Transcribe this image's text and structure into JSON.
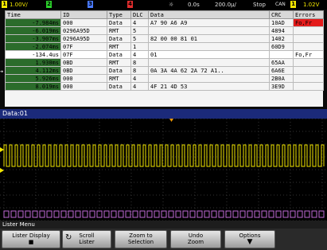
{
  "status": {
    "ch1_num": "1",
    "ch1_scale": "1.00V/",
    "ch2_num": "2",
    "ch3_num": "3",
    "ch4_num": "4",
    "trig_icon": "sun-icon",
    "delay": "0.0s",
    "timebase": "200.0µ/",
    "run_state": "Stop",
    "trigger_source": "CAN",
    "trigger_ch": "1",
    "trigger_level": "1.02V"
  },
  "lister": {
    "headers": [
      "Time",
      "ID",
      "Type",
      "DLC",
      "Data",
      "CRC",
      "Errors"
    ],
    "rows": [
      {
        "time": "-7.984ms",
        "id": "000",
        "type": "Data",
        "dlc": "4",
        "data": "A7 90 A6 A9",
        "crc": "10AD",
        "errors": "Fo,Fr"
      },
      {
        "time": "-6.019ms",
        "id": "0296A95D",
        "type": "RMT",
        "dlc": "5",
        "data": "",
        "crc": "4894",
        "errors": ""
      },
      {
        "time": "-3.907ms",
        "id": "0296A95D",
        "type": "Data",
        "dlc": "5",
        "data": "82 00 00 81 01",
        "crc": "1402",
        "errors": ""
      },
      {
        "time": "-2.074ms",
        "id": "07F",
        "type": "RMT",
        "dlc": "1",
        "data": "",
        "crc": "60D9",
        "errors": ""
      },
      {
        "time": "-134.4us",
        "id": "07F",
        "type": "Data",
        "dlc": "4",
        "data": "01",
        "crc": "",
        "errors": "Fo,Fr"
      },
      {
        "time": "1.930ms",
        "id": "0BD",
        "type": "RMT",
        "dlc": "8",
        "data": "",
        "crc": "65AA",
        "errors": ""
      },
      {
        "time": "4.112ms",
        "id": "0BD",
        "type": "Data",
        "dlc": "8",
        "data": "0A 3A 4A 62 2A 72 A1..",
        "crc": "6A6E",
        "errors": ""
      },
      {
        "time": "5.926ms",
        "id": "000",
        "type": "RMT",
        "dlc": "4",
        "data": "",
        "crc": "2B0A",
        "errors": ""
      },
      {
        "time": "8.019ms",
        "id": "000",
        "type": "Data",
        "dlc": "4",
        "data": "4F 21 4D 53",
        "crc": "3E9D",
        "errors": ""
      }
    ],
    "selected_row": 4
  },
  "data_label": "Data:01",
  "menu_title": "Lister Menu",
  "softkeys": [
    {
      "label": "Lister Display",
      "sub": ""
    },
    {
      "label": "Scroll",
      "sub": "Lister"
    },
    {
      "label": "Zoom to",
      "sub": "Selection"
    },
    {
      "label": "Undo",
      "sub": "Zoom"
    },
    {
      "label": "Options",
      "sub": ""
    }
  ],
  "colors": {
    "ch1": "#f2e600",
    "ch2": "#2bd12b",
    "ch3": "#4a7bff",
    "ch4": "#e02d2d",
    "error": "#e41b1b",
    "time_cell": "#2b6c2b"
  }
}
